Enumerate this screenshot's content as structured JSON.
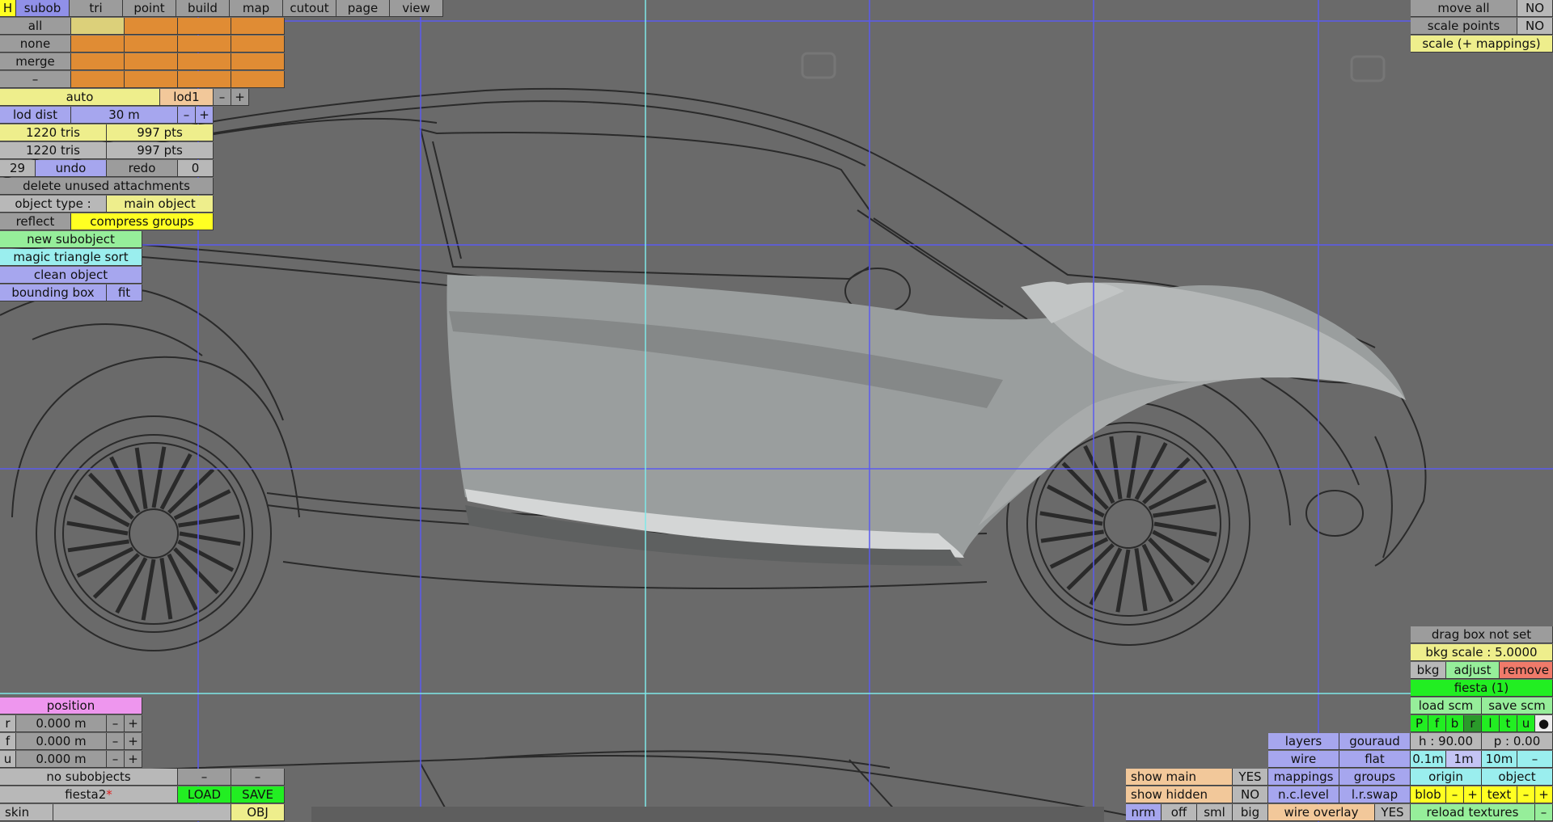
{
  "top_tabs": [
    "H",
    "subob",
    "tri",
    "point",
    "build",
    "map",
    "cutout",
    "page",
    "view"
  ],
  "subob_rows": [
    "all",
    "none",
    "merge",
    "–"
  ],
  "lod": {
    "mode": "auto",
    "level": "lod1",
    "minus": "–",
    "plus": "+",
    "dist_label": "lod dist",
    "dist_value": "30 m"
  },
  "stats": [
    {
      "tris": "1220 tris",
      "pts": "997 pts"
    },
    {
      "tris": "1220 tris",
      "pts": "997 pts"
    }
  ],
  "history": {
    "undo_count": "29",
    "undo": "undo",
    "redo": "redo",
    "redo_count": "0"
  },
  "delete_unused": "delete unused attachments",
  "object_type": {
    "label": "object type :",
    "value": "main object"
  },
  "reflect": "reflect",
  "compress_groups": "compress groups",
  "new_subobject": "new subobject",
  "magic_sort": "magic triangle sort",
  "clean_object": "clean object",
  "bounding_box": {
    "label": "bounding box",
    "fit": "fit"
  },
  "top_right": {
    "move_all": "move all",
    "move_all_val": "NO",
    "scale_points": "scale points",
    "scale_points_val": "NO",
    "scale_mappings": "scale (+ mappings)"
  },
  "position": {
    "title": "position",
    "rows": [
      {
        "axis": "r",
        "value": "0.000 m"
      },
      {
        "axis": "f",
        "value": "0.000 m"
      },
      {
        "axis": "u",
        "value": "0.000 m"
      }
    ],
    "minus": "–",
    "plus": "+"
  },
  "file": {
    "no_subobjects": "no subobjects",
    "dash": "–",
    "name": "fiesta2",
    "modified_mark": "*",
    "load": "LOAD",
    "save": "SAVE",
    "skin": "skin",
    "obj": "OBJ"
  },
  "bkg": {
    "drag_box": "drag box not set",
    "scale": "bkg scale : 5.0000",
    "bkg": "bkg",
    "adjust": "adjust",
    "remove": "remove",
    "name": "fiesta (1)",
    "load_scm": "load scm",
    "save_scm": "save scm",
    "views": [
      "P",
      "f",
      "b",
      "r",
      "l",
      "t",
      "u",
      "●"
    ]
  },
  "camera": {
    "h": "h : 90.00",
    "p": "p : 0.00",
    "steps": [
      "0.1m",
      "1m",
      "10m",
      "–"
    ],
    "origin": "origin",
    "object": "object"
  },
  "render": {
    "layers": "layers",
    "gouraud": "gouraud",
    "wire": "wire",
    "flat": "flat",
    "mappings": "mappings",
    "groups": "groups",
    "nclevel": "n.c.level",
    "lrswap": "l.r.swap",
    "wire_overlay": "wire overlay",
    "wire_overlay_val": "YES"
  },
  "show": {
    "main": "show main",
    "main_val": "YES",
    "hidden": "show hidden",
    "hidden_val": "NO"
  },
  "normals": [
    "nrm",
    "off",
    "sml",
    "big"
  ],
  "blob": {
    "label": "blob",
    "minus": "–",
    "plus": "+"
  },
  "text": {
    "label": "text",
    "minus": "–",
    "plus": "+"
  },
  "reload_textures": "reload textures",
  "colors": {
    "grid_line": "#5a5af0",
    "axis_line": "#7ee8e8",
    "viewport": "#6a6a6a"
  }
}
